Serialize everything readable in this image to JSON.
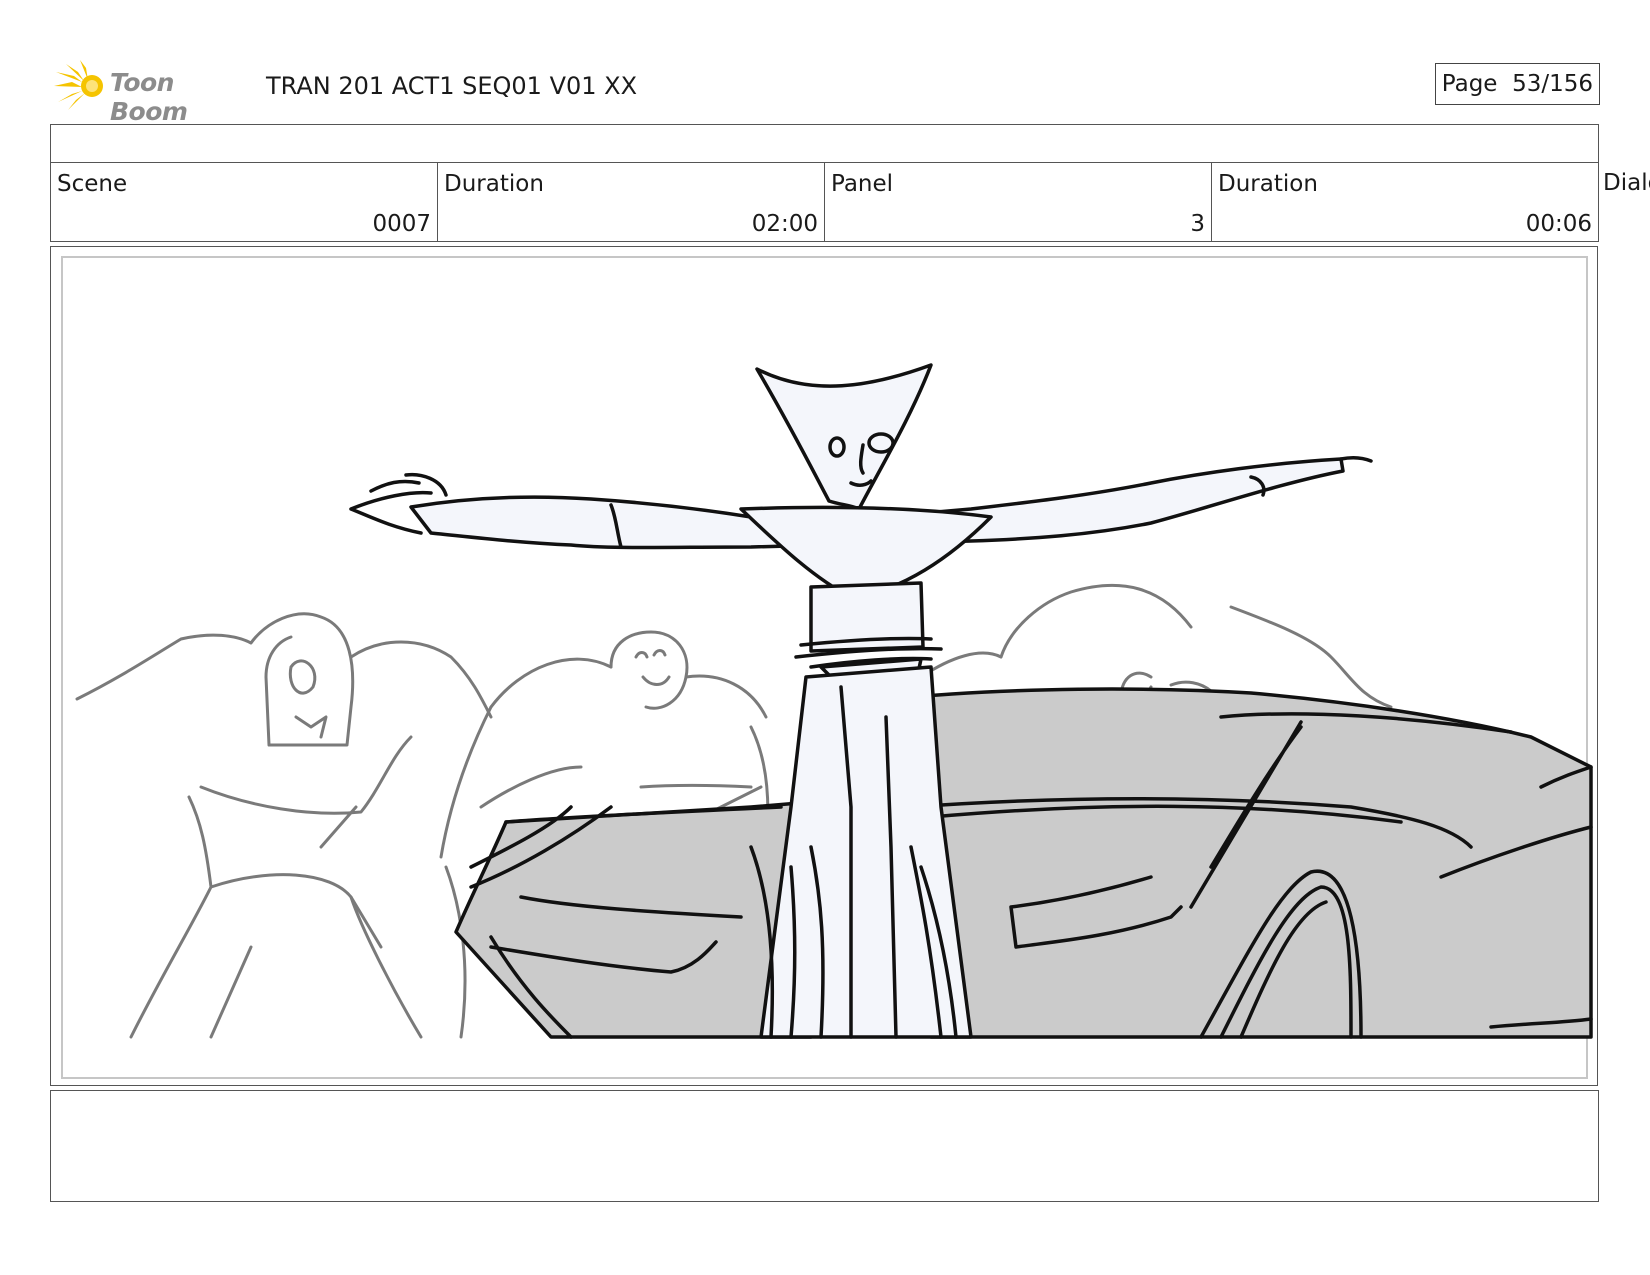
{
  "brand": {
    "name": "Toon Boom",
    "icon": "burst-logo-icon",
    "color": "#f5c400"
  },
  "document": {
    "title": "TRAN 201 ACT1 SEQ01 V01 XX",
    "page_label": "Page",
    "page_value": "53/156"
  },
  "info": {
    "scene_label": "Scene",
    "scene_value": "0007",
    "scene_duration_label": "Duration",
    "scene_duration_value": "02:00",
    "panel_label": "Panel",
    "panel_value": "3",
    "panel_duration_label": "Duration",
    "panel_duration_value": "00:06",
    "dialog_label": "Dialo"
  },
  "notes": {
    "text": ""
  }
}
